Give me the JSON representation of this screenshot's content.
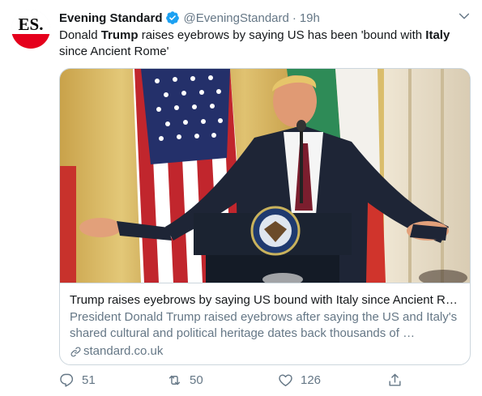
{
  "account": {
    "avatar_text": "ES.",
    "name": "Evening Standard",
    "handle": "@EveningStandard",
    "separator": "·",
    "time": "19h"
  },
  "tweet": {
    "text_parts": [
      "Donald ",
      "Trump",
      " raises eyebrows by saying US has been 'bound with ",
      "Italy",
      " since Ancient Rome'"
    ]
  },
  "card": {
    "title": "Trump raises eyebrows by saying US bound with Italy since Ancient R…",
    "description": "President Donald Trump raised eyebrows after saying the US and Italy's shared cultural and political heritage dates back thousands of …",
    "domain": "standard.co.uk"
  },
  "actions": {
    "replies": "51",
    "retweets": "50",
    "likes": "126"
  },
  "colors": {
    "text": "#14171a",
    "muted": "#657786",
    "verified": "#1da1f2",
    "border": "#ccd6dd",
    "brand_red": "#e5001c"
  },
  "icons": [
    "verified-badge-icon",
    "chevron-down-icon",
    "link-icon",
    "reply-icon",
    "retweet-icon",
    "like-icon",
    "share-icon"
  ]
}
